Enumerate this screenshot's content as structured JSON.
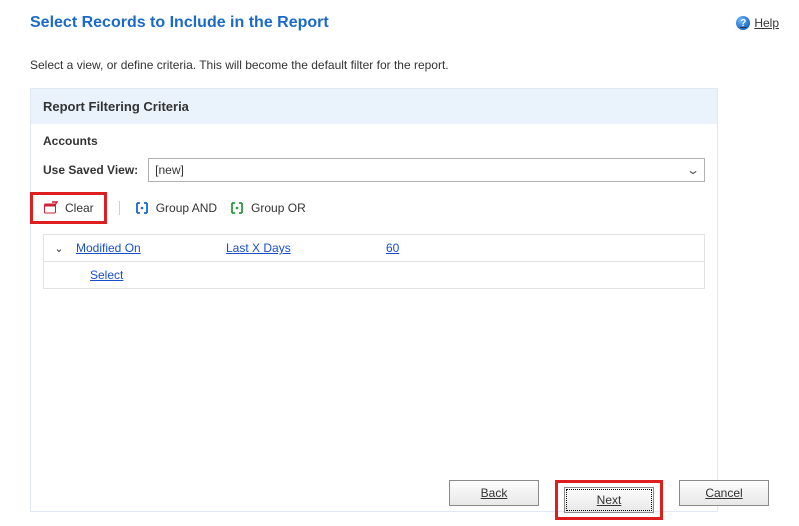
{
  "header": {
    "title": "Select Records to Include in the Report",
    "help_label": "Help"
  },
  "subtitle": "Select a view, or define criteria. This will become the default filter for the report.",
  "panel": {
    "title": "Report Filtering Criteria",
    "entity": "Accounts",
    "saved_view_label": "Use Saved View:",
    "saved_view_value": "[new]"
  },
  "toolbar": {
    "clear": "Clear",
    "group_and": "Group AND",
    "group_or": "Group OR"
  },
  "criteria": {
    "rows": [
      {
        "field": "Modified On",
        "operator": "Last X Days",
        "value": "60"
      }
    ],
    "select_row": "Select"
  },
  "footer": {
    "back": "Back",
    "next": "Next",
    "cancel": "Cancel"
  }
}
